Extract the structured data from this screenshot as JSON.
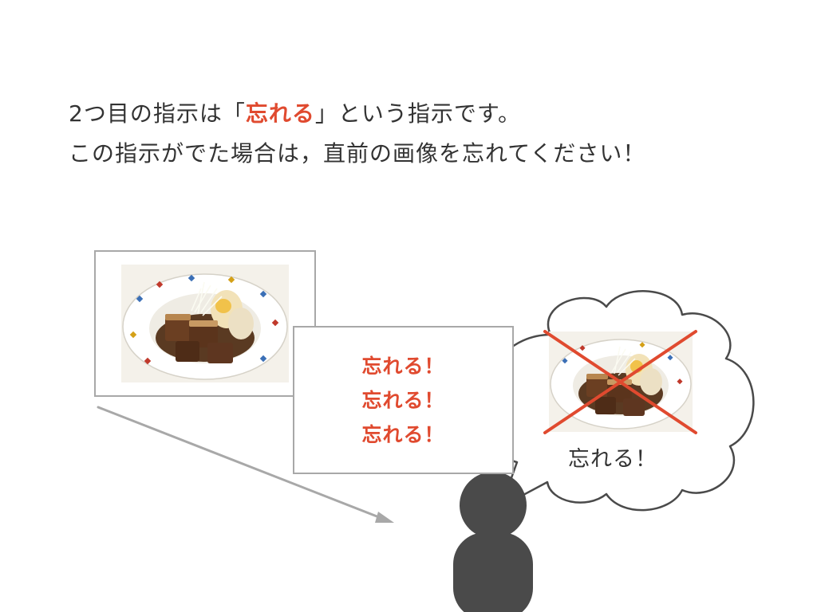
{
  "intro": {
    "line1": {
      "prefix": "2つ目の指示は「",
      "highlight": "忘れる",
      "suffix": "」という指示です。"
    },
    "line2": "この指示がでた場合は，直前の画像を忘れてください！"
  },
  "instruction_card": {
    "lines": [
      "忘れる！",
      "忘れる！",
      "忘れる！"
    ]
  },
  "thought_bubble": {
    "label": "忘れる！"
  },
  "colors": {
    "accent": "#e04a2f",
    "text": "#333333",
    "person": "#4a4a4a",
    "arrow": "#a8a8a8",
    "border": "#a8a8a8"
  },
  "icons": {
    "person": "person-silhouette-icon",
    "cross": "cross-out-icon"
  }
}
